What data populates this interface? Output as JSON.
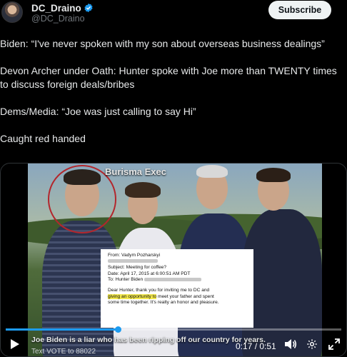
{
  "account": {
    "name": "DC_Draino",
    "handle": "@DC_Draino",
    "subscribe_label": "Subscribe"
  },
  "tweet": {
    "paragraphs": [
      "Biden: “I've never spoken with my son about overseas business dealings”",
      "Devon Archer under Oath: Hunter spoke with Joe more than TWENTY times to discuss foreign deals/bribes",
      "Dems/Media: “Joe was just calling to say Hi”",
      "Caught red handed"
    ]
  },
  "video": {
    "overlay_title": "Burisma Exec",
    "email": {
      "from": "From: Vadym Pozharskyi",
      "subject": "Subject: Meeting for coffee?",
      "date": "Date: April 17, 2015 at 6:00:51 AM PDT",
      "to": "To: Hunter Biden",
      "body_pre": "Dear Hunter, thank you  for inviting me to DC and",
      "body_highlight": "giving an opportunity to",
      "body_post": " meet your father and spent",
      "body_line3": "some time together. It's realty an honor and pleasure."
    },
    "caption": "Joe Biden is a liar who has been ripping off our country for years.",
    "subcaption": "Text VOTE to 88022",
    "current_time": "0:17",
    "duration": "0:51",
    "progress": 0.333
  },
  "colors": {
    "accent": "#1d9bf0",
    "verified": "#1d9bf0",
    "circle": "#b3262c",
    "highlight": "#f2e84c"
  }
}
